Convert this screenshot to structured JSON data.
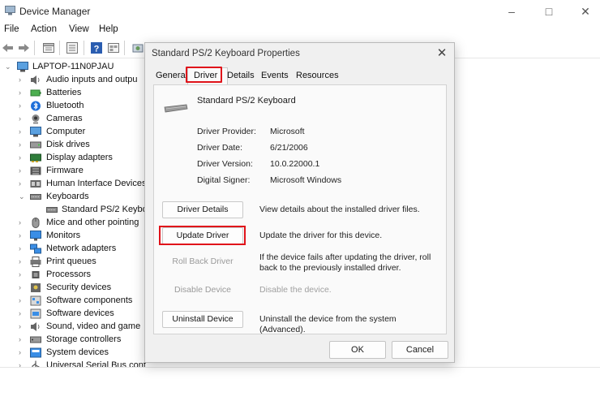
{
  "window": {
    "title": "Device Manager",
    "controls": [
      "minimize",
      "maximize",
      "close"
    ]
  },
  "menu": [
    "File",
    "Action",
    "View",
    "Help"
  ],
  "toolbar": {
    "buttons": [
      "back-arrow-icon",
      "forward-arrow-icon",
      "properties-icon",
      "list-icon",
      "help-icon",
      "view-icon",
      "scan-icon"
    ]
  },
  "tree": {
    "root": "LAPTOP-11N0PJAU",
    "items": [
      "Audio inputs and outpu",
      "Batteries",
      "Bluetooth",
      "Cameras",
      "Computer",
      "Disk drives",
      "Display adapters",
      "Firmware",
      "Human Interface Devices",
      "Keyboards",
      "Standard PS/2 Keybo",
      "Mice and other pointing",
      "Monitors",
      "Network adapters",
      "Print queues",
      "Processors",
      "Security devices",
      "Software components",
      "Software devices",
      "Sound, video and game",
      "Storage controllers",
      "System devices",
      "Universal Serial Bus cont"
    ]
  },
  "dialog": {
    "title": "Standard PS/2 Keyboard Properties",
    "tabs": [
      "General",
      "Driver",
      "Details",
      "Events",
      "Resources"
    ],
    "active_tab": "Driver",
    "device_name": "Standard PS/2 Keyboard",
    "info": {
      "provider_label": "Driver Provider:",
      "provider_value": "Microsoft",
      "date_label": "Driver Date:",
      "date_value": "6/21/2006",
      "version_label": "Driver Version:",
      "version_value": "10.0.22000.1",
      "signer_label": "Digital Signer:",
      "signer_value": "Microsoft Windows"
    },
    "actions": {
      "details_label": "Driver Details",
      "details_desc": "View details about the installed driver files.",
      "update_label": "Update Driver",
      "update_desc": "Update the driver for this device.",
      "rollback_label": "Roll Back Driver",
      "rollback_desc": "If the device fails after updating the driver, roll back to the previously installed driver.",
      "disable_label": "Disable Device",
      "disable_desc": "Disable the device.",
      "uninstall_label": "Uninstall Device",
      "uninstall_desc": "Uninstall the device from the system (Advanced)."
    },
    "ok_label": "OK",
    "cancel_label": "Cancel"
  },
  "colors": {
    "highlight": "#e0131a",
    "dialog_bg": "#f0f0f0",
    "panel_bg": "#fafafa"
  }
}
